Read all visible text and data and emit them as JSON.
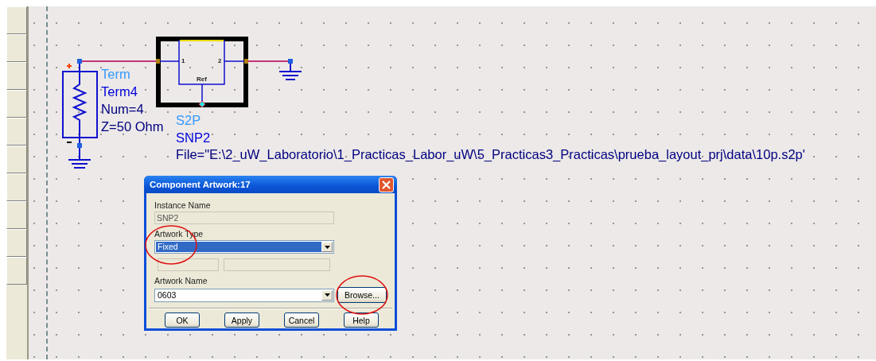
{
  "schematic": {
    "term": {
      "labels": [
        "Term",
        "Term4",
        "Num=4",
        "Z=50 Ohm"
      ]
    },
    "snp": {
      "pins": [
        "1",
        "2"
      ],
      "ref": "Ref",
      "labels": [
        "S2P",
        "SNP2",
        "File=\"E:\\2_uW_Laboratorio\\1_Practicas_Labor_uW\\5_Practicas3_Practicas\\prueba_layout_prj\\data\\10p.s2p'"
      ]
    }
  },
  "dialog": {
    "title": "Component Artwork:17",
    "instance_name": {
      "label": "Instance Name",
      "value": "SNP2",
      "disabled": true
    },
    "artwork_type": {
      "label": "Artwork Type",
      "value": "Fixed",
      "selected": true
    },
    "extra_fields": [
      {
        "disabled": true
      },
      {
        "disabled": true
      }
    ],
    "artwork_name": {
      "label": "Artwork Name",
      "value": "0603"
    },
    "browse": "Browse...",
    "buttons": [
      "OK",
      "Apply",
      "Cancel",
      "Help"
    ]
  }
}
